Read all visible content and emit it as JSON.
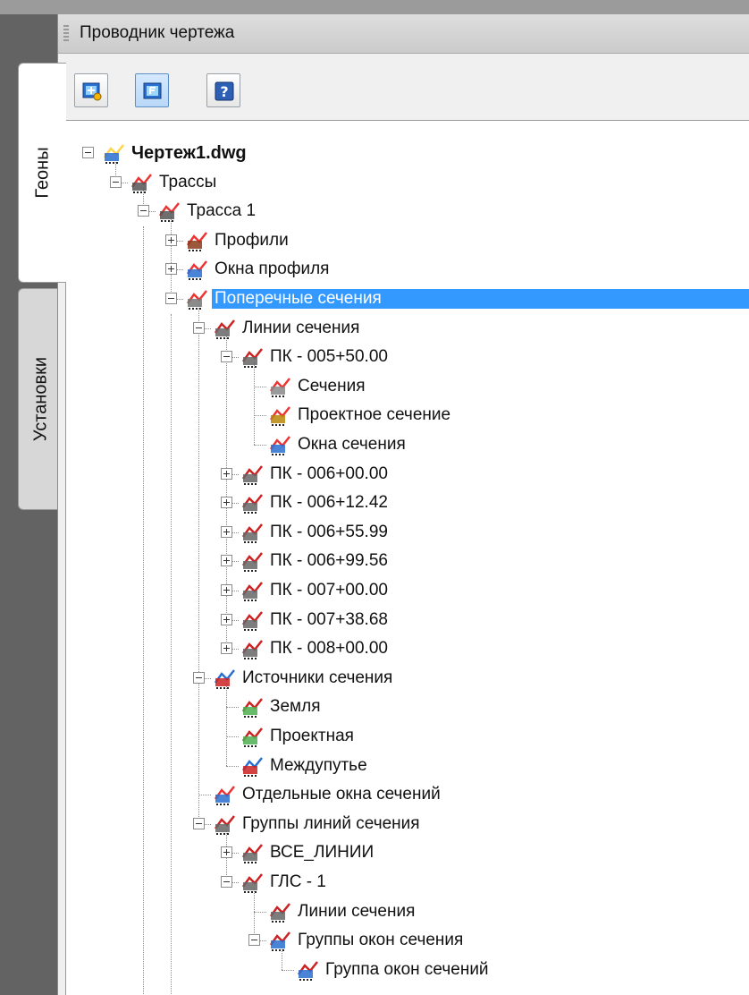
{
  "panel": {
    "title": "Проводник чертежа"
  },
  "tabs": [
    {
      "label": "Геоны",
      "active": true
    },
    {
      "label": "Установки",
      "active": false
    }
  ],
  "toolbar": {
    "buttons": [
      {
        "icon": "toolspace-view-icon"
      },
      {
        "icon": "prospector-icon",
        "pressed": true
      },
      {
        "icon": "help-icon"
      }
    ]
  },
  "tree": [
    {
      "label": "Чертеж1.dwg",
      "depth": 0,
      "expander": "minus",
      "icon": "drawing-icon",
      "bold": true
    },
    {
      "label": "Трассы",
      "depth": 1,
      "expander": "minus",
      "icon": "alignments-icon"
    },
    {
      "label": "Трасса 1",
      "depth": 2,
      "expander": "minus",
      "icon": "alignment-icon"
    },
    {
      "label": "Профили",
      "depth": 3,
      "expander": "plus",
      "icon": "profiles-icon"
    },
    {
      "label": "Окна профиля",
      "depth": 3,
      "expander": "plus",
      "icon": "profile-views-icon"
    },
    {
      "label": "Поперечные сечения",
      "depth": 3,
      "expander": "minus",
      "icon": "sample-lines-icon",
      "selected": true
    },
    {
      "label": "Линии сечения",
      "depth": 4,
      "expander": "minus",
      "icon": "sample-line-group-icon"
    },
    {
      "label": "ПК - 005+50.00",
      "depth": 5,
      "expander": "minus",
      "icon": "sample-line-icon"
    },
    {
      "label": "Сечения",
      "depth": 6,
      "expander": "none",
      "icon": "sections-icon"
    },
    {
      "label": "Проектное сечение",
      "depth": 6,
      "expander": "none",
      "icon": "corridor-section-icon"
    },
    {
      "label": "Окна сечения",
      "depth": 6,
      "expander": "none",
      "icon": "section-views-icon"
    },
    {
      "label": "ПК - 006+00.00",
      "depth": 5,
      "expander": "plus",
      "icon": "sample-line-icon"
    },
    {
      "label": "ПК - 006+12.42",
      "depth": 5,
      "expander": "plus",
      "icon": "sample-line-icon"
    },
    {
      "label": "ПК - 006+55.99",
      "depth": 5,
      "expander": "plus",
      "icon": "sample-line-icon"
    },
    {
      "label": "ПК - 006+99.56",
      "depth": 5,
      "expander": "plus",
      "icon": "sample-line-icon"
    },
    {
      "label": "ПК - 007+00.00",
      "depth": 5,
      "expander": "plus",
      "icon": "sample-line-icon"
    },
    {
      "label": "ПК - 007+38.68",
      "depth": 5,
      "expander": "plus",
      "icon": "sample-line-icon"
    },
    {
      "label": "ПК - 008+00.00",
      "depth": 5,
      "expander": "plus",
      "icon": "sample-line-icon"
    },
    {
      "label": "Источники сечения",
      "depth": 4,
      "expander": "minus",
      "icon": "section-sources-icon"
    },
    {
      "label": "Земля",
      "depth": 5,
      "expander": "none",
      "icon": "surface-source-icon"
    },
    {
      "label": "Проектная",
      "depth": 5,
      "expander": "none",
      "icon": "surface-source-icon"
    },
    {
      "label": "Междупутье",
      "depth": 5,
      "expander": "none",
      "icon": "section-source-icon"
    },
    {
      "label": "Отдельные окна сечений",
      "depth": 4,
      "expander": "none",
      "icon": "section-views-icon"
    },
    {
      "label": "Группы линий сечения",
      "depth": 4,
      "expander": "minus",
      "icon": "sample-line-groups-icon"
    },
    {
      "label": "ВСЕ_ЛИНИИ",
      "depth": 5,
      "expander": "plus",
      "icon": "sample-line-groups-icon"
    },
    {
      "label": "ГЛС - 1",
      "depth": 5,
      "expander": "minus",
      "icon": "sample-line-groups-icon"
    },
    {
      "label": "Линии сечения",
      "depth": 6,
      "expander": "none",
      "icon": "sample-line-icon"
    },
    {
      "label": "Группы окон сечения",
      "depth": 6,
      "expander": "minus",
      "icon": "section-view-groups-icon"
    },
    {
      "label": "Группа окон сечений",
      "depth": 7,
      "expander": "none",
      "icon": "section-view-groups-icon"
    }
  ]
}
